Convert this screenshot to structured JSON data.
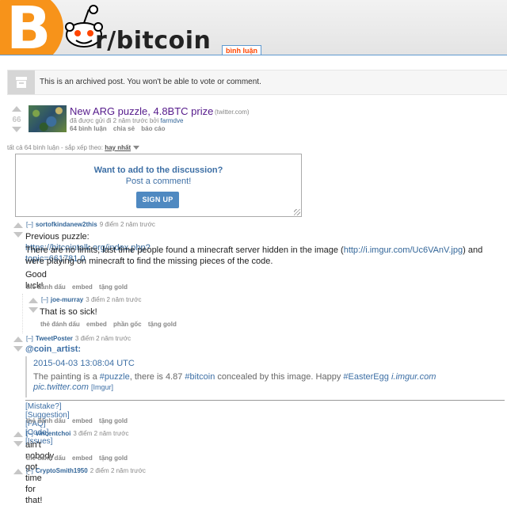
{
  "header": {
    "logo_glyph": "B",
    "subreddit": "r/bitcoin",
    "tab_label": "bình luận",
    "brand_color": "#f7931a"
  },
  "archived": {
    "text": "This is an archived post. You won't be able to vote or comment."
  },
  "post": {
    "score": "66",
    "title": "New ARG puzzle, 4.8BTC prize",
    "domain": "(twitter.com)",
    "tagline_prefix": "đã được gửi đi 2 năm trước bởi",
    "author": "farmdve",
    "buttons": [
      "64 bình luận",
      "chia sẻ",
      "báo cáo"
    ]
  },
  "sort_bar": {
    "text": "tất cả 64 bình luận - sắp xếp theo:",
    "selected": "hay nhất"
  },
  "discussion": {
    "title": "Want to add to the discussion?",
    "subtitle": "Post a comment!",
    "button": "SIGN UP"
  },
  "comments": [
    {
      "expand": "[–]",
      "author": "sortofkindanew2this",
      "meta": "9 điểm 2 năm trước",
      "intro": "Previous puzzle:",
      "link": "https://bitcointalk.org/index.php?topic=661781.0",
      "para_a": "There are no limits, last time people found a minecraft server hidden in the image (",
      "para_link": "http://i.imgur.com/Uc6VAnV.jpg",
      "para_b": ") and were playing on minecraft to find the missing pieces of the code.",
      "closing": "Good luck!",
      "buttons": [
        "thẻ đánh dấu",
        "embed",
        "tặng gold"
      ]
    },
    {
      "expand": "[–]",
      "author": "joe-murray",
      "meta": "3 điểm 2 năm trước",
      "text": "That is so sick!",
      "buttons": [
        "thẻ đánh dấu",
        "embed",
        "phần gốc",
        "tặng gold"
      ]
    },
    {
      "expand": "[–]",
      "author": "TweetPoster",
      "meta": "3 điểm 2 năm trước",
      "handle": "@coin_artist:",
      "date": "2015-04-03 13:08:04 UTC",
      "tweet_a": "The painting is a ",
      "tag1": "#puzzle",
      "tweet_b": ", there is 4.87 ",
      "tag2": "#bitcoin",
      "tweet_c": " concealed by this image. Happy ",
      "tag3": "#EasterEgg",
      "link1": "i.imgur.com",
      "link2": "pic.twitter.com",
      "imgur": "[Imgur]",
      "bot_links": [
        "[Mistake?]",
        "[Suggestion]",
        "[FAQ]",
        "[Code]",
        "[Issues]"
      ],
      "buttons": [
        "thẻ đánh dấu",
        "embed",
        "tặng gold"
      ]
    },
    {
      "expand": "[–]",
      "author": "vincentchoi",
      "meta": "3 điểm 2 năm trước",
      "text": "ain't nobody got time for that!",
      "buttons": [
        "thẻ đánh dấu",
        "embed",
        "tặng gold"
      ]
    },
    {
      "expand": "[–]",
      "author": "CryptoSmith1950",
      "meta": "2 điểm 2 năm trước"
    }
  ]
}
